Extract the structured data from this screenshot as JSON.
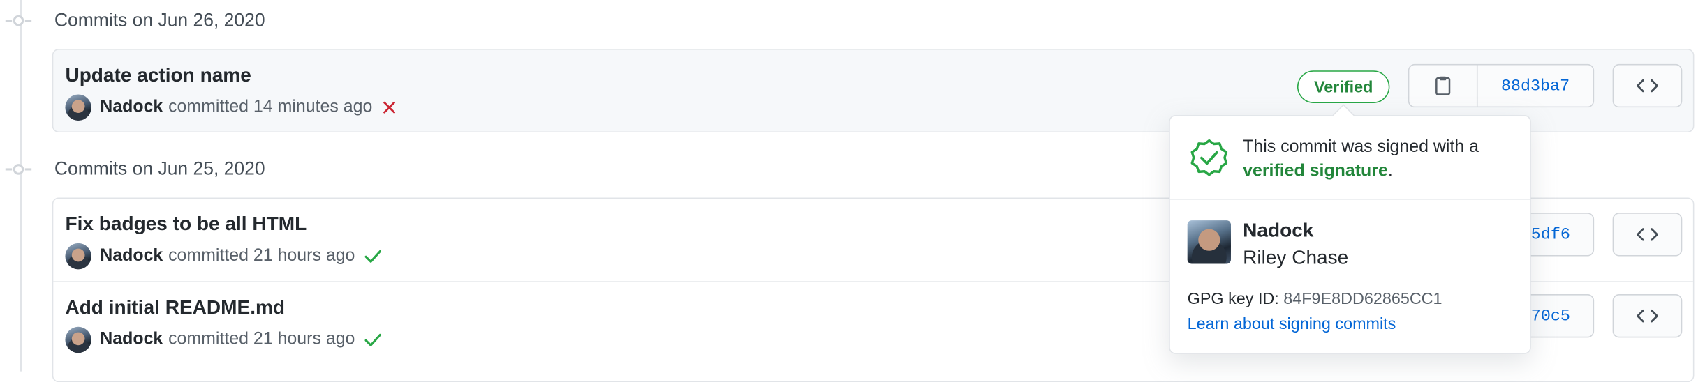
{
  "groups": [
    {
      "title": "Commits on Jun 26, 2020",
      "commits": [
        {
          "title": "Update action name",
          "author": "Nadock",
          "committed_text": "committed 14 minutes ago",
          "status": "failure",
          "status_icon": "x-icon",
          "verified_label": "Verified",
          "sha": "88d3ba7"
        }
      ]
    },
    {
      "title": "Commits on Jun 25, 2020",
      "commits": [
        {
          "title": "Fix badges to be all HTML",
          "author": "Nadock",
          "committed_text": "committed 21 hours ago",
          "status": "success",
          "status_icon": "check-icon",
          "sha_visible": "5df6"
        },
        {
          "title": "Add initial README.md",
          "author": "Nadock",
          "committed_text": "committed 21 hours ago",
          "status": "success",
          "status_icon": "check-icon",
          "sha_visible": "70c5"
        }
      ]
    }
  ],
  "popover": {
    "message_prefix": "This commit was signed with a",
    "message_link": "verified signature",
    "message_suffix": ".",
    "signer_login": "Nadock",
    "signer_name": "Riley Chase",
    "gpg_label": "GPG key ID:",
    "gpg_key": "84F9E8DD62865CC1",
    "learn_link": "Learn about signing commits"
  },
  "colors": {
    "verified_green": "#28a745",
    "link_blue": "#0366d6",
    "failure_red": "#cb2431",
    "text_muted": "#586069"
  }
}
